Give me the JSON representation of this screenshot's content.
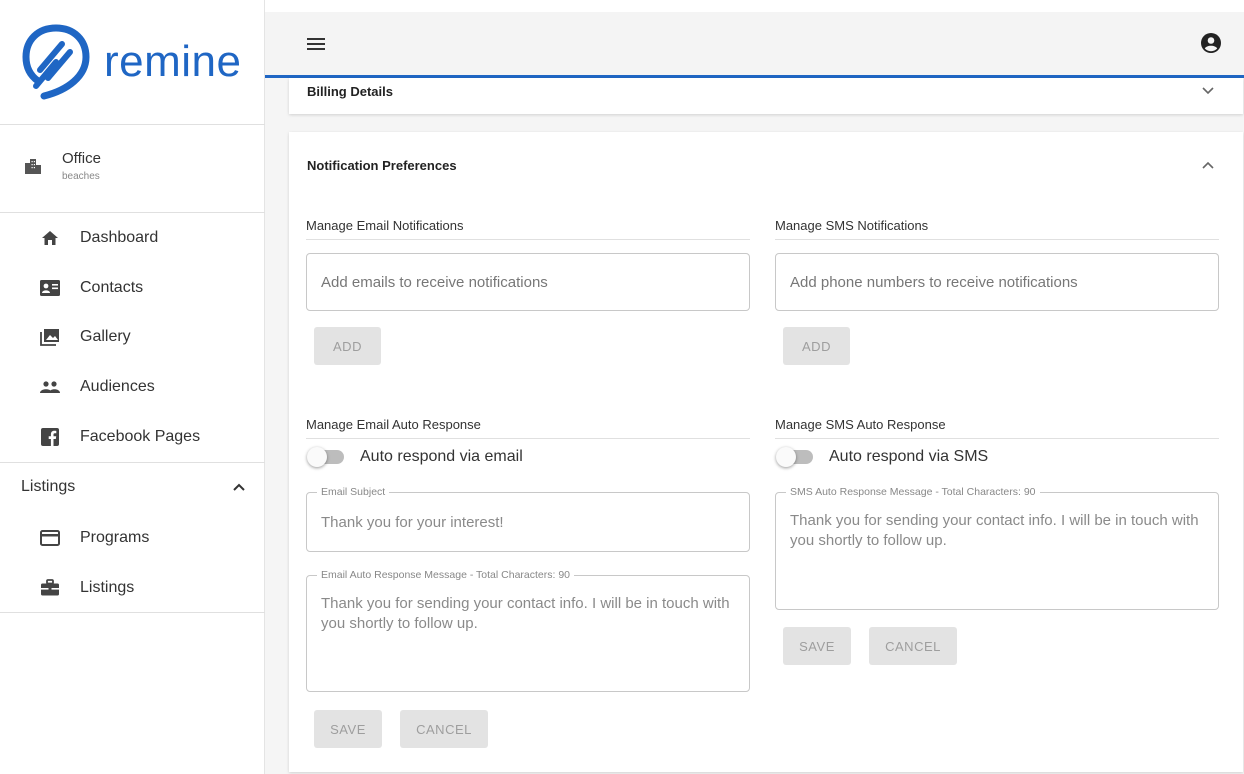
{
  "brand": {
    "name": "remine",
    "color": "#1f66c4"
  },
  "office": {
    "title": "Office",
    "subtitle": "beaches",
    "icon": "office-building-icon"
  },
  "nav": [
    {
      "label": "Dashboard",
      "icon": "home-icon"
    },
    {
      "label": "Contacts",
      "icon": "contact-card-icon"
    },
    {
      "label": "Gallery",
      "icon": "gallery-icon"
    },
    {
      "label": "Audiences",
      "icon": "people-icon"
    },
    {
      "label": "Facebook Pages",
      "icon": "facebook-icon"
    }
  ],
  "listings_section": {
    "label": "Listings",
    "items": [
      {
        "label": "Programs",
        "icon": "card-icon"
      },
      {
        "label": "Listings",
        "icon": "briefcase-icon"
      }
    ]
  },
  "billing": {
    "title": "Billing Details"
  },
  "notifications": {
    "title": "Notification Preferences",
    "email": {
      "heading": "Manage Email Notifications",
      "placeholder": "Add emails to receive notifications",
      "add_label": "ADD"
    },
    "sms": {
      "heading": "Manage SMS Notifications",
      "placeholder": "Add phone numbers to receive notifications",
      "add_label": "ADD"
    },
    "email_auto": {
      "heading": "Manage Email Auto Response",
      "toggle_label": "Auto respond via email",
      "subject_legend": "Email Subject",
      "subject_value": "Thank you for your interest!",
      "message_legend": "Email Auto Response Message - Total Characters: 90",
      "message_value": "Thank you for sending your contact info. I will be in touch with you shortly to follow up.",
      "save_label": "SAVE",
      "cancel_label": "CANCEL"
    },
    "sms_auto": {
      "heading": "Manage SMS Auto Response",
      "toggle_label": "Auto respond via SMS",
      "message_legend": "SMS Auto Response Message - Total Characters: 90",
      "message_value": "Thank you for sending your contact info. I will be in touch with you shortly to follow up.",
      "save_label": "SAVE",
      "cancel_label": "CANCEL"
    }
  }
}
